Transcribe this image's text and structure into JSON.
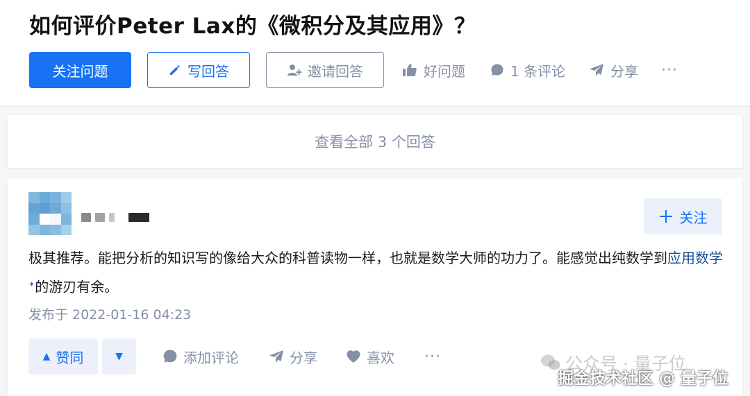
{
  "question": {
    "title": "如何评价Peter Lax的《微积分及其应用》？",
    "follow_label": "关注问题",
    "write_answer_label": "写回答",
    "invite_label": "邀请回答",
    "good_question_label": "好问题",
    "comment_label": "1 条评论",
    "share_label": "分享",
    "more_label": "···"
  },
  "view_all_label": "查看全部 3 个回答",
  "answer": {
    "follow_label": "关注",
    "content_before_link": "极其推荐。能把分析的知识写的像给大众的科普读物一样，也就是数学大师的功力了。能感觉出纯数学到",
    "link_text": "应用数学",
    "link_mark": "✦",
    "content_after_link": "的游刃有余。",
    "published": "发布于 2022-01-16 04:23",
    "upvote_label": "赞同",
    "upvote_icon": "▲",
    "downvote_icon": "▼",
    "add_comment_label": "添加评论",
    "share_label": "分享",
    "like_label": "喜欢",
    "more_label": "···"
  },
  "watermark": {
    "line1": "公众号 · 量子位",
    "line2": "掘金技术社区 @ 量子位"
  },
  "colors": {
    "primary": "#1772f6",
    "muted": "#8590a6",
    "link": "#175199",
    "soft_blue_bg": "#ebf0fb"
  }
}
